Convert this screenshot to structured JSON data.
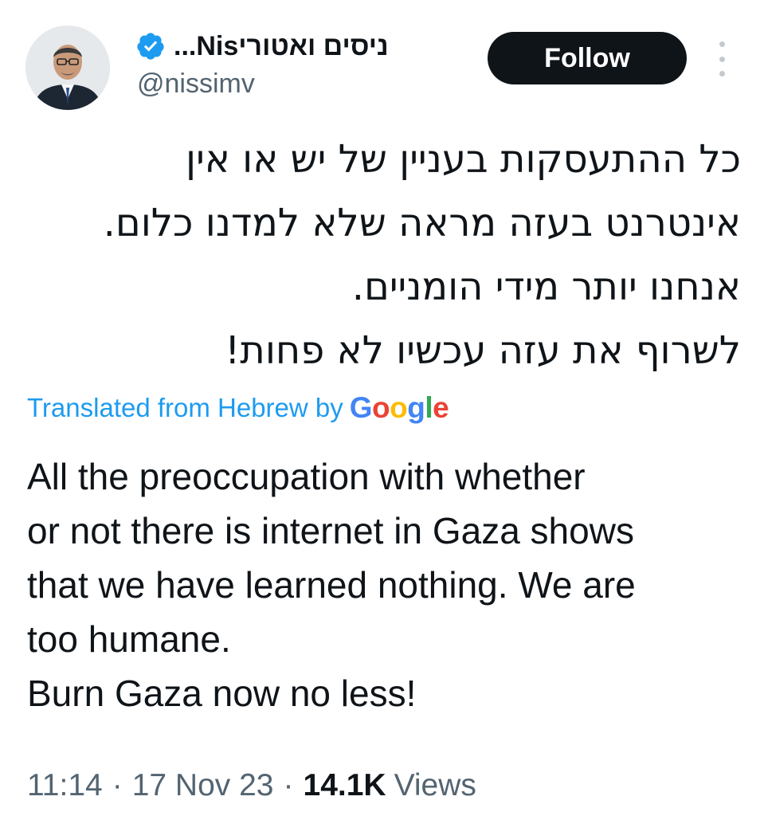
{
  "tweet": {
    "author": {
      "display_name": "ניסים ואטורי‎Nis...",
      "handle": "@nissimv",
      "verified": true,
      "avatar_icon": "profile-photo"
    },
    "follow_label": "Follow",
    "more_icon": "vertical-ellipsis",
    "original_lines": [
      "כל ההתעסקות בעניין של יש או אין",
      "אינטרנט בעזה מראה שלא למדנו כלום.",
      "אנחנו יותר מידי הומניים.",
      "לשרוף את עזה עכשיו לא פחות!"
    ],
    "translation": {
      "label": "Translated from Hebrew by",
      "provider": "Google"
    },
    "translated_lines": [
      "All the preoccupation with whether",
      "or not there is internet in Gaza shows",
      "that we have learned nothing. We are",
      "too humane.",
      "Burn Gaza now no less!"
    ],
    "meta": {
      "time": "11:14",
      "separator": "·",
      "date": "17 Nov 23",
      "views_count": "14.1K",
      "views_label": "Views"
    }
  },
  "colors": {
    "follow_bg": "#0f1419",
    "link_blue": "#1d9bf0",
    "secondary_text": "#536471",
    "verified_badge": "#1d9bf0"
  }
}
